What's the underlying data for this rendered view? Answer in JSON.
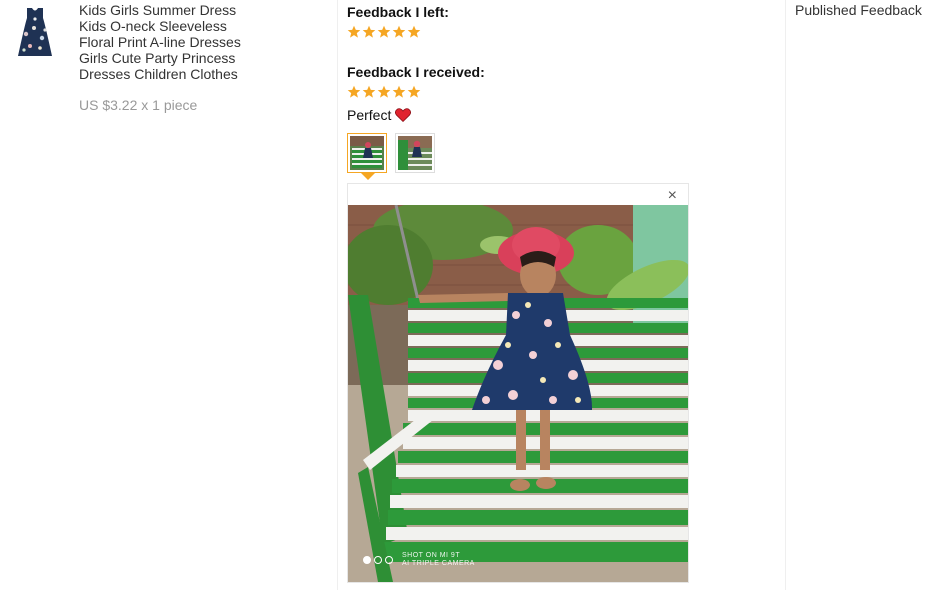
{
  "product": {
    "thumbnail": "floral-dress-thumbnail",
    "title_lines": [
      "Kids Girls Summer Dress",
      "Kids O-neck Sleeveless",
      "Floral Print A-line Dresses",
      "Girls Cute Party Princess",
      "Dresses Children Clothes"
    ],
    "price": "US $3.22 x 1 piece"
  },
  "feedback_left": {
    "heading": "Feedback I left:",
    "rating": 5,
    "max_rating": 5
  },
  "feedback_received": {
    "heading": "Feedback I received:",
    "rating": 5,
    "max_rating": 5,
    "comment": "Perfect",
    "comment_icon": "heart-icon",
    "photos": [
      {
        "name": "photo-1",
        "selected": true
      },
      {
        "name": "photo-2",
        "selected": false
      }
    ]
  },
  "viewer": {
    "close_icon": "close-icon",
    "close_label": "×",
    "watermark_lines": [
      "SHOT ON MI 9T",
      "AI TRIPLE CAMERA"
    ],
    "dots": [
      true,
      false,
      false
    ]
  },
  "published": {
    "label": "Published Feedback"
  },
  "colors": {
    "star": "#f5a623",
    "heart": "#e0242f",
    "price": "#999999",
    "selected_border": "#f5a623"
  }
}
